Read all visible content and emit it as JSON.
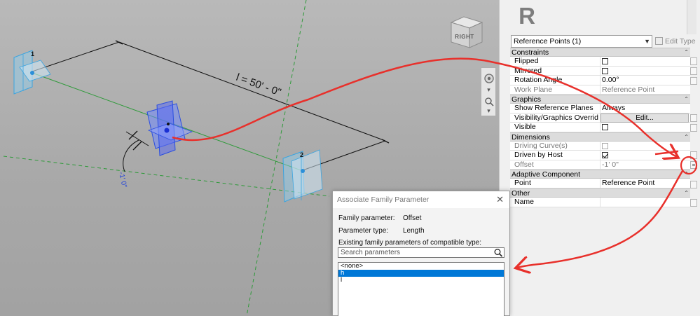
{
  "viewport": {
    "dimension_label": "l = 50' - 0\"",
    "offset_label": "-1' 0\"",
    "point_labels": [
      "1",
      "2"
    ],
    "view_cube_label": "RIGHT"
  },
  "properties": {
    "logo": "R",
    "type_selector": "Reference Points (1)",
    "edit_type_label": "Edit Type",
    "groups": [
      {
        "name": "Constraints",
        "rows": [
          {
            "name": "Flipped",
            "kind": "check",
            "checked": false
          },
          {
            "name": "Mirrored",
            "kind": "check",
            "checked": false
          },
          {
            "name": "Rotation Angle",
            "kind": "text",
            "value": "0.00°"
          },
          {
            "name": "Work Plane",
            "kind": "text",
            "value": "Reference Point",
            "disabled": true
          }
        ]
      },
      {
        "name": "Graphics",
        "rows": [
          {
            "name": "Show Reference Planes",
            "kind": "text",
            "value": "Always"
          },
          {
            "name": "Visibility/Graphics Overrides",
            "kind": "button",
            "value": "Edit..."
          },
          {
            "name": "Visible",
            "kind": "check",
            "checked": false
          }
        ]
      },
      {
        "name": "Dimensions",
        "rows": [
          {
            "name": "Driving Curve(s)",
            "kind": "check",
            "checked": false,
            "disabled": true
          },
          {
            "name": "Driven by Host",
            "kind": "check",
            "checked": true
          },
          {
            "name": "Offset",
            "kind": "text",
            "value": "-1'  0\"",
            "disabled": true
          }
        ]
      },
      {
        "name": "Adaptive Component",
        "rows": [
          {
            "name": "Point",
            "kind": "text",
            "value": "Reference Point"
          }
        ]
      },
      {
        "name": "Other",
        "rows": [
          {
            "name": "Name",
            "kind": "text",
            "value": ""
          }
        ]
      }
    ]
  },
  "dialog": {
    "title": "Associate Family Parameter",
    "family_parameter_label": "Family parameter:",
    "family_parameter_value": "Offset",
    "parameter_type_label": "Parameter type:",
    "parameter_type_value": "Length",
    "existing_label": "Existing family parameters of compatible type:",
    "search_placeholder": "Search parameters",
    "items": [
      "<none>",
      "h",
      "l"
    ],
    "selected_index": 1
  },
  "colors": {
    "annotation": "#e8302b",
    "selection": "#0078d7",
    "reference_plane": "#3aa4e0",
    "work_plane_line": "#2f9a3a"
  }
}
